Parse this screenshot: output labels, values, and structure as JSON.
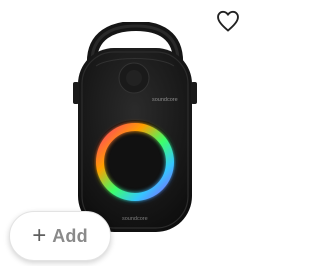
{
  "product": {
    "brand_mark": "soundcore",
    "accent_colors": [
      "#ff3b6b",
      "#ffa000",
      "#3cff6a",
      "#35c6ff",
      "#8a5cff"
    ]
  },
  "favorite": {
    "icon": "heart-outline-icon"
  },
  "add_button": {
    "icon": "plus-icon",
    "plus": "+",
    "label": "Add"
  }
}
